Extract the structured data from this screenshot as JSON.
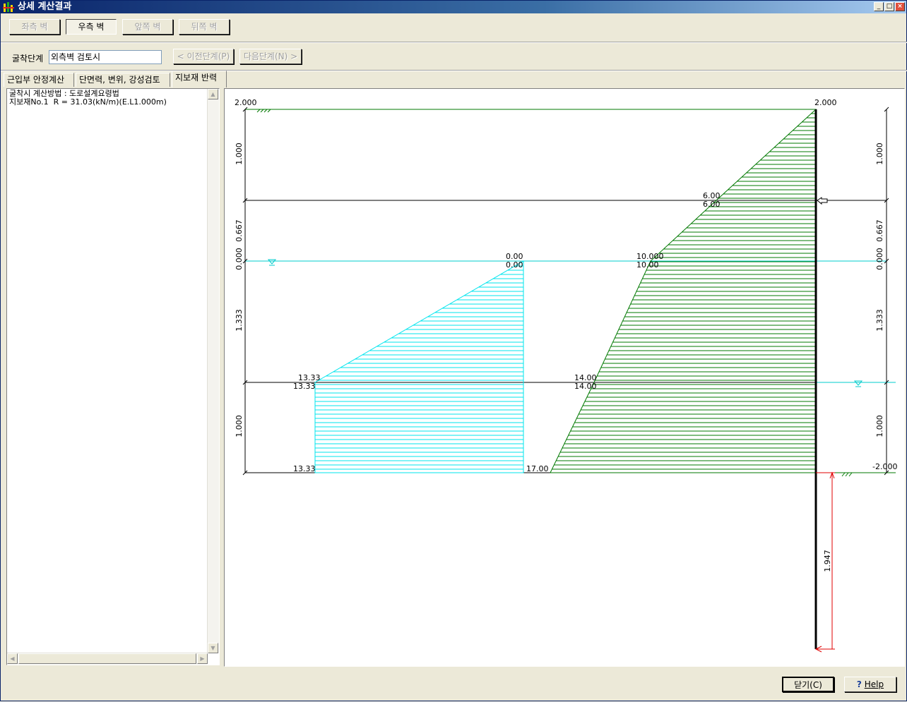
{
  "window": {
    "title": "상세 계산결과"
  },
  "toolbar": {
    "left_wall": "좌측 벽",
    "right_wall": "우측 벽",
    "front_wall": "앞쪽 벽",
    "back_wall": "뒤쪽 벽"
  },
  "stage": {
    "label": "굴착단계",
    "value": "외측벽 검토시",
    "prev": "< 이전단계(P)",
    "next": "다음단계(N) >"
  },
  "tabs": [
    "근입부 안정계산",
    "단면력, 변위, 강성검토",
    "지보재 반력"
  ],
  "report": [
    "굴착시 계산방법 : 도로설계요령법",
    "지보재No.1  R = 31.03(kN/m)(E.L1.000m)"
  ],
  "diagram": {
    "left_elev": [
      "2.000"
    ],
    "right_elev": [
      "2.000",
      "-2.000"
    ],
    "left_dims": [
      "1.000",
      "0.667",
      "0.000",
      "1.333",
      "1.000"
    ],
    "right_dims": [
      "1.000",
      "0.667",
      "0.000",
      "1.333",
      "1.000"
    ],
    "cyan_labels": [
      "0.00",
      "0.00",
      "13.33",
      "13.33",
      "13.33"
    ],
    "green_labels": [
      "6.00",
      "6.00",
      "10.000",
      "10.00",
      "14.00",
      "14.00",
      "17.00"
    ],
    "embed_depth": "1.947"
  },
  "footer": {
    "close": "닫기(C)",
    "help": "Help"
  },
  "colors": {
    "cyan": "#00e5ee",
    "green": "#007800",
    "red": "#e00000",
    "title": "#0a246a"
  }
}
